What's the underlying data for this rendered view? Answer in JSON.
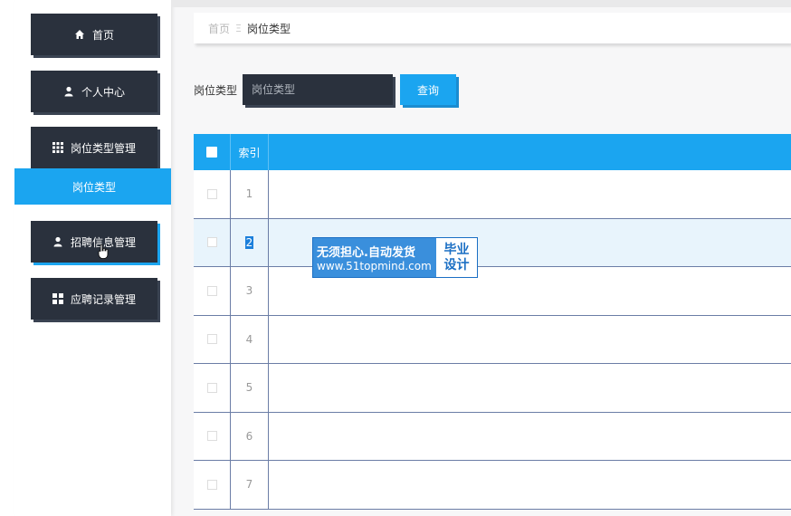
{
  "sidebar": {
    "items": [
      {
        "label": "首页",
        "icon": "home-icon"
      },
      {
        "label": "个人中心",
        "icon": "user-icon"
      },
      {
        "label": "岗位类型管理",
        "icon": "grid-icon"
      },
      {
        "label": "招聘信息管理",
        "icon": "user-icon"
      },
      {
        "label": "应聘记录管理",
        "icon": "grid-four-icon"
      }
    ],
    "sub_item": {
      "label": "岗位类型"
    }
  },
  "breadcrumb": {
    "home": "首页",
    "separator": "Ξ",
    "current": "岗位类型"
  },
  "search": {
    "label": "岗位类型",
    "placeholder": "岗位类型",
    "button": "查询"
  },
  "table": {
    "headers": [
      "索引"
    ],
    "rows": [
      "1",
      "2",
      "3",
      "4",
      "5",
      "6",
      "7"
    ],
    "highlighted_row": "2"
  },
  "watermark": {
    "line1": "无须担心.自动发货",
    "line2": "www.51topmind.com",
    "right1": "毕业",
    "right2": "设计"
  },
  "colors": {
    "accent": "#1ba5f0",
    "dark": "#2a313d"
  }
}
